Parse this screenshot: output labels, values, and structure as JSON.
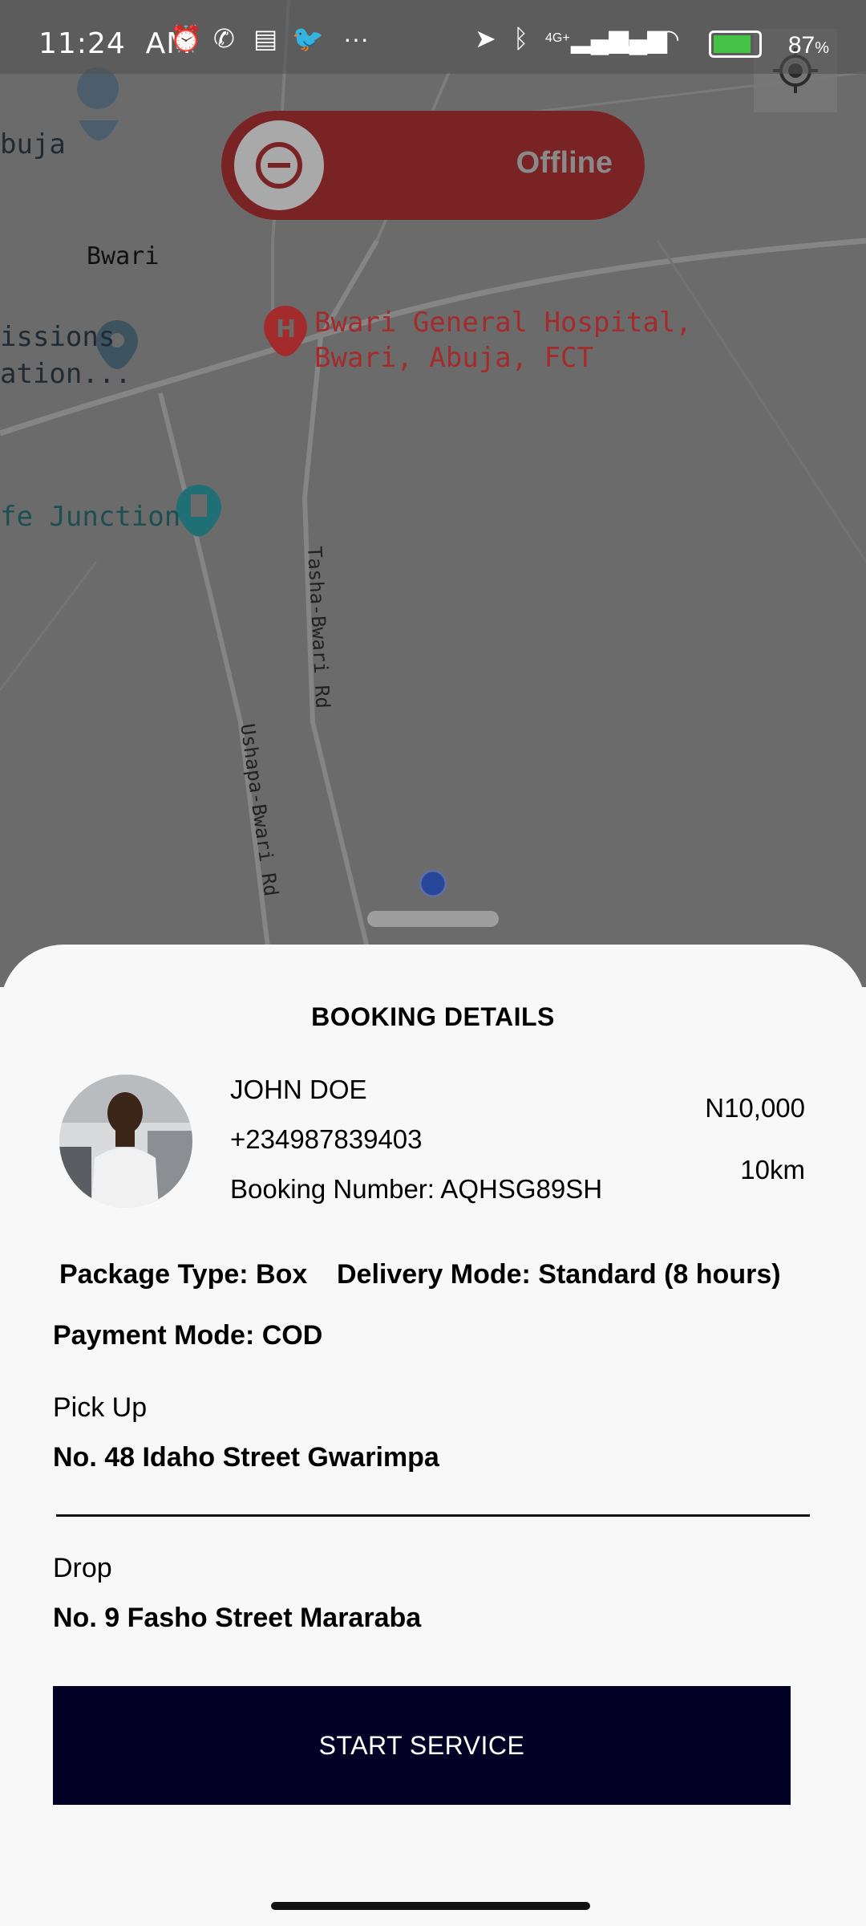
{
  "status_bar": {
    "time": "11:24",
    "ampm": "AM",
    "network": "4G+",
    "battery": "87",
    "battery_unit": "%",
    "icons": [
      "alarm-icon",
      "messenger-icon",
      "message-icon",
      "twitter-icon",
      "more-icon",
      "location-arrow-icon",
      "bluetooth-icon",
      "signal-icon",
      "wifi-icon",
      "battery-icon"
    ]
  },
  "map": {
    "labels": {
      "place_abuja": "buja",
      "place_bwari": "Bwari",
      "missions_line1": "issions",
      "missions_line2": "ation...",
      "hospital_line1": "Bwari General Hospital,",
      "hospital_line2": "Bwari, Abuja, FCT",
      "junction": "fe Junction",
      "road_tasha": "Tasha-Bwari Rd",
      "road_ushapa": "Ushapa-Bwari Rd"
    }
  },
  "toggle": {
    "label": "Offline",
    "state": "offline"
  },
  "booking": {
    "title": "BOOKING DETAILS",
    "customer_name": "JOHN DOE",
    "customer_phone": "+234987839403",
    "booking_number": "Booking Number: AQHSG89SH",
    "price": "N10,000",
    "distance": "10km",
    "package_type": "Package Type: Box",
    "delivery_mode": "Delivery Mode: Standard (8 hours)",
    "payment_mode": "Payment Mode: COD",
    "pickup_label": "Pick Up",
    "pickup_address": "No. 48 Idaho Street Gwarimpa",
    "drop_label": "Drop",
    "drop_address": "No. 9 Fasho Street Mararaba",
    "start_button": "START SERVICE"
  },
  "colors": {
    "toggle_bg": "#7a2325",
    "button_bg": "#020125",
    "map_bg": "#6b6b6b"
  }
}
